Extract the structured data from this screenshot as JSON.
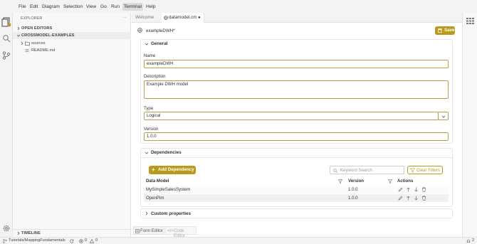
{
  "menu": [
    "File",
    "Edit",
    "Diagram",
    "Selection",
    "View",
    "Go",
    "Run",
    "Terminal",
    "Help"
  ],
  "sidebar": {
    "title": "EXPLORER",
    "more": "···",
    "open_editors": "OPEN EDITORS",
    "workspace": "CROSSMODEL-EXAMPLES",
    "folder": "sources",
    "file": "README.md",
    "timeline": "TIMELINE"
  },
  "tabs": [
    {
      "label": "Welcome"
    },
    {
      "label": "datamodel.cm",
      "dirty": "●"
    }
  ],
  "editor": {
    "header_title": "exampleDWH*",
    "save_label": "Save",
    "general": {
      "title": "General",
      "name_label": "Name",
      "name_value": "exampleDWH",
      "description_label": "Description",
      "description_value": "Example DWH model",
      "type_label": "Type",
      "type_value": "Logical",
      "version_label": "Version",
      "version_value": "1.0.0"
    },
    "dependencies": {
      "title": "Dependencies",
      "add_label": "Add Dependency",
      "search_placeholder": "Keyword Search",
      "clear_label": "Clear Filters",
      "columns": [
        "Data Model",
        "Version",
        "Actions"
      ],
      "rows": [
        {
          "model": "MySimpleSalesSystem",
          "version": "1.0.0"
        },
        {
          "model": "OpenPim",
          "version": "1.0.0"
        }
      ]
    },
    "custom_properties": "Custom properties",
    "bottom_tabs": [
      "Form Editor",
      "Code Editor"
    ]
  },
  "status": {
    "branch": "Tutorials/MappingFundamentals",
    "errors": "0",
    "warnings": "0",
    "notifications": "2"
  },
  "colors": {
    "accent": "#b89a1c",
    "input_border": "#b8a14a"
  }
}
